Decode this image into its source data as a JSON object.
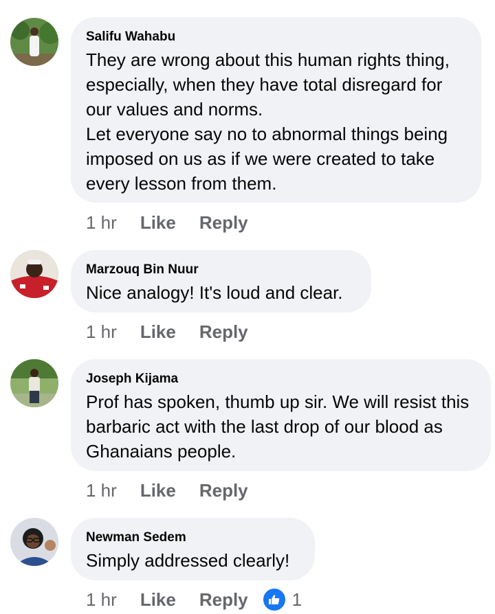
{
  "comments": [
    {
      "author": "Salifu Wahabu",
      "avatar_icon": "profile-photo-outdoor-trees",
      "text": "They are wrong about this human rights thing, especially, when they have total disregard for our values and norms.\nLet everyone say no to abnormal things being imposed on us as if we were created to take every lesson from them.",
      "time": "1 hr",
      "like_label": "Like",
      "reply_label": "Reply"
    },
    {
      "author": "Marzouq Bin Nuur",
      "avatar_icon": "profile-photo-red-outfit",
      "text": "Nice analogy! It's loud and clear.",
      "time": "1 hr",
      "like_label": "Like",
      "reply_label": "Reply"
    },
    {
      "author": "Joseph Kijama",
      "avatar_icon": "profile-photo-standing-outdoors",
      "text": "Prof has spoken, thumb up sir. We will resist this barbaric act with the last drop of our blood as Ghanaians people.",
      "time": "1 hr",
      "like_label": "Like",
      "reply_label": "Reply"
    },
    {
      "author": "Newman Sedem",
      "avatar_icon": "profile-photo-glasses",
      "text": "Simply addressed clearly!",
      "time": "1 hr",
      "like_label": "Like",
      "reply_label": "Reply",
      "reaction": {
        "icon": "thumbs-up-icon",
        "count": "1",
        "color": "#1877f2"
      }
    }
  ]
}
